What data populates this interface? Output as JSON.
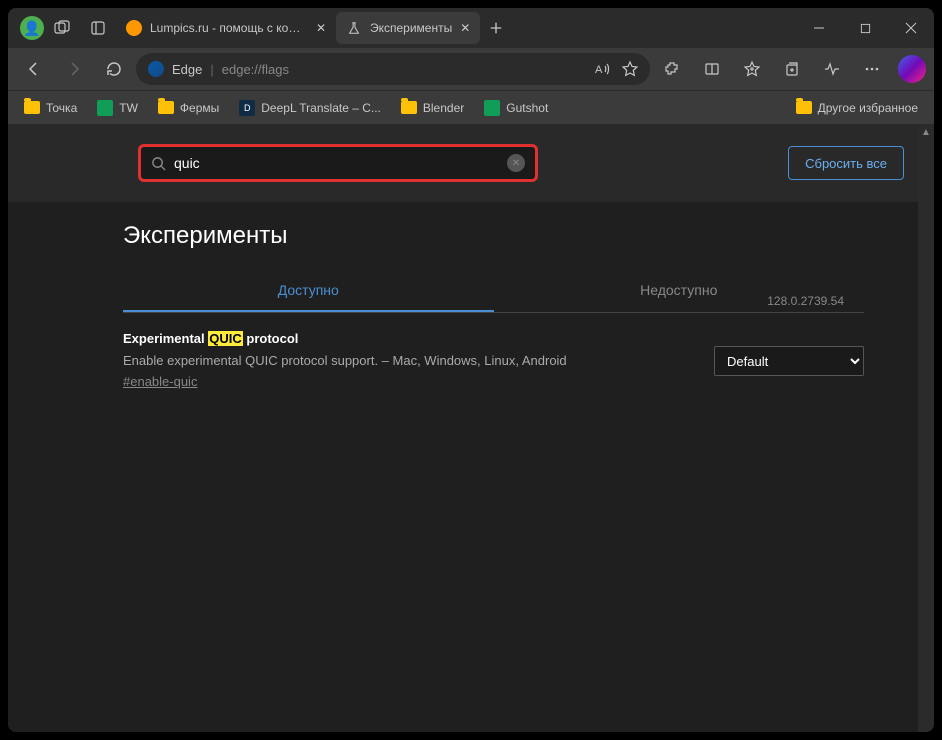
{
  "tabs": [
    {
      "label": "Lumpics.ru - помощь с компьюте",
      "active": false
    },
    {
      "label": "Эксперименты",
      "active": true
    }
  ],
  "address": {
    "brand": "Edge",
    "url": "edge://flags"
  },
  "bookmarks": {
    "items": [
      {
        "label": "Точка",
        "icon": "folder"
      },
      {
        "label": "TW",
        "icon": "sheet"
      },
      {
        "label": "Фермы",
        "icon": "folder"
      },
      {
        "label": "DeepL Translate – С...",
        "icon": "deepl"
      },
      {
        "label": "Blender",
        "icon": "folder"
      },
      {
        "label": "Gutshot",
        "icon": "sheet"
      }
    ],
    "other": "Другое избранное"
  },
  "search": {
    "value": "quic"
  },
  "reset_label": "Сбросить все",
  "page_title": "Эксперименты",
  "version": "128.0.2739.54",
  "pagetabs": {
    "available": "Доступно",
    "unavailable": "Недоступно"
  },
  "flag": {
    "title_pre": "Experimental ",
    "title_hl": "QUIC",
    "title_post": " protocol",
    "desc": "Enable experimental QUIC protocol support. – Mac, Windows, Linux, Android",
    "link": "#enable-quic",
    "select": "Default"
  }
}
